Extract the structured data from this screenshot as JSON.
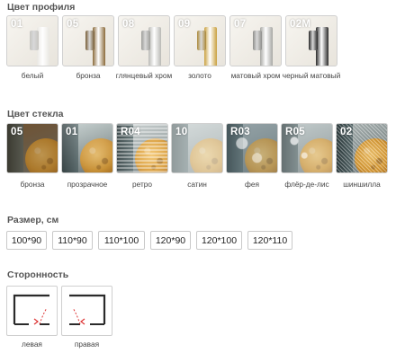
{
  "profile": {
    "title": "Цвет профиля",
    "items": [
      {
        "code": "01",
        "label": "белый",
        "color": "#e9e7e2"
      },
      {
        "code": "05",
        "label": "бронза",
        "color": "#8a6a3a"
      },
      {
        "code": "08",
        "label": "глянцевый хром",
        "color": "#b9b9b5"
      },
      {
        "code": "09",
        "label": "золото",
        "color": "#c9a040"
      },
      {
        "code": "07",
        "label": "матовый хром",
        "color": "#a7a7a3"
      },
      {
        "code": "02M",
        "label": "черный матовый",
        "color": "#2a2a2a"
      }
    ]
  },
  "glass": {
    "title": "Цвет стекла",
    "items": [
      {
        "code": "05",
        "label": "бронза",
        "tint": "#7c5d3c"
      },
      {
        "code": "01",
        "label": "прозрачное",
        "tint": "#b8c5c4"
      },
      {
        "code": "R04",
        "label": "ретро",
        "tint": "#c8cfcf"
      },
      {
        "code": "10",
        "label": "сатин",
        "tint": "#c2c9c9"
      },
      {
        "code": "R03",
        "label": "фея",
        "tint": "#a6b1b3"
      },
      {
        "code": "R05",
        "label": "флёр-де-лис",
        "tint": "#bcc6c7"
      },
      {
        "code": "02",
        "label": "шиншилла",
        "tint": "#aeb7b6"
      }
    ]
  },
  "size": {
    "title": "Размер, см",
    "options": [
      "100*90",
      "110*90",
      "110*100",
      "120*90",
      "120*100",
      "120*110"
    ]
  },
  "side": {
    "title": "Сторонность",
    "options": [
      {
        "label": "левая",
        "icon": "left-hinge-door-icon"
      },
      {
        "label": "правая",
        "icon": "right-hinge-door-icon"
      }
    ]
  }
}
